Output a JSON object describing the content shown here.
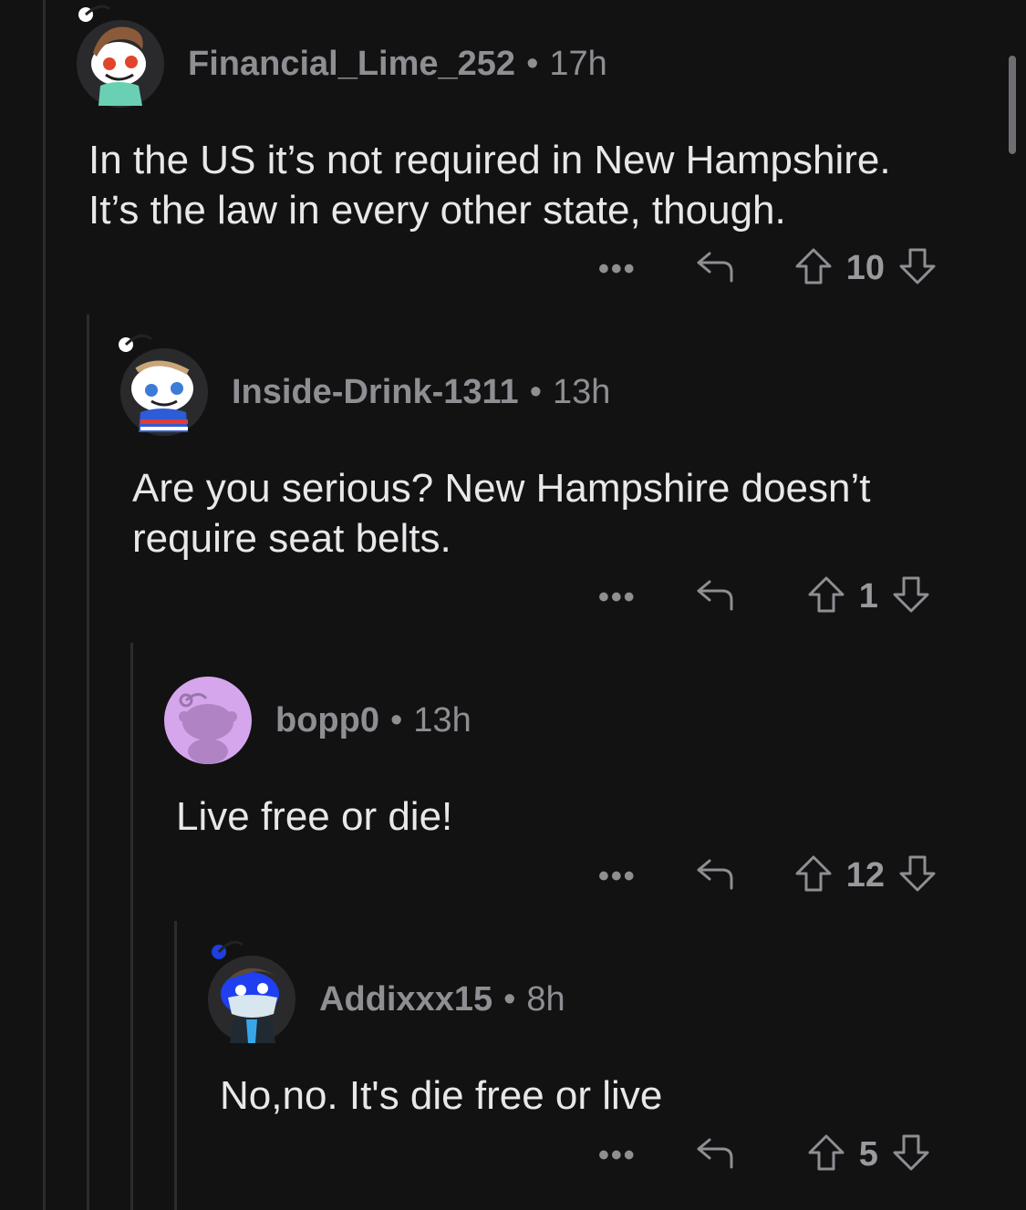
{
  "comments": [
    {
      "username": "Financial_Lime_252",
      "separator": "•",
      "time": "17h",
      "body": "In the US it’s not required in New Hampshire.\nIt’s the law in every other state, though.",
      "more": "•••",
      "score": "10"
    },
    {
      "username": "Inside-Drink-1311",
      "separator": "•",
      "time": "13h",
      "body": "Are you serious? New Hampshire doesn’t\nrequire seat belts.",
      "more": "•••",
      "score": "1"
    },
    {
      "username": "bopp0",
      "separator": "•",
      "time": "13h",
      "body": "Live free or die!",
      "more": "•••",
      "score": "12"
    },
    {
      "username": "Addixxx15",
      "separator": "•",
      "time": "8h",
      "body": "No,no. It's die free or live",
      "more": "•••",
      "score": "5"
    }
  ],
  "icons": {
    "reply": "reply-arrow-icon",
    "upvote": "upvote-arrow-icon",
    "downvote": "downvote-arrow-icon",
    "more": "ellipsis-icon"
  },
  "colors": {
    "background": "#121213",
    "text": "#e8e8ea",
    "meta": "#8e8e93",
    "thread_line": "#2c2c2e",
    "bopp0_avatar_bg": "#d6a6ec"
  }
}
